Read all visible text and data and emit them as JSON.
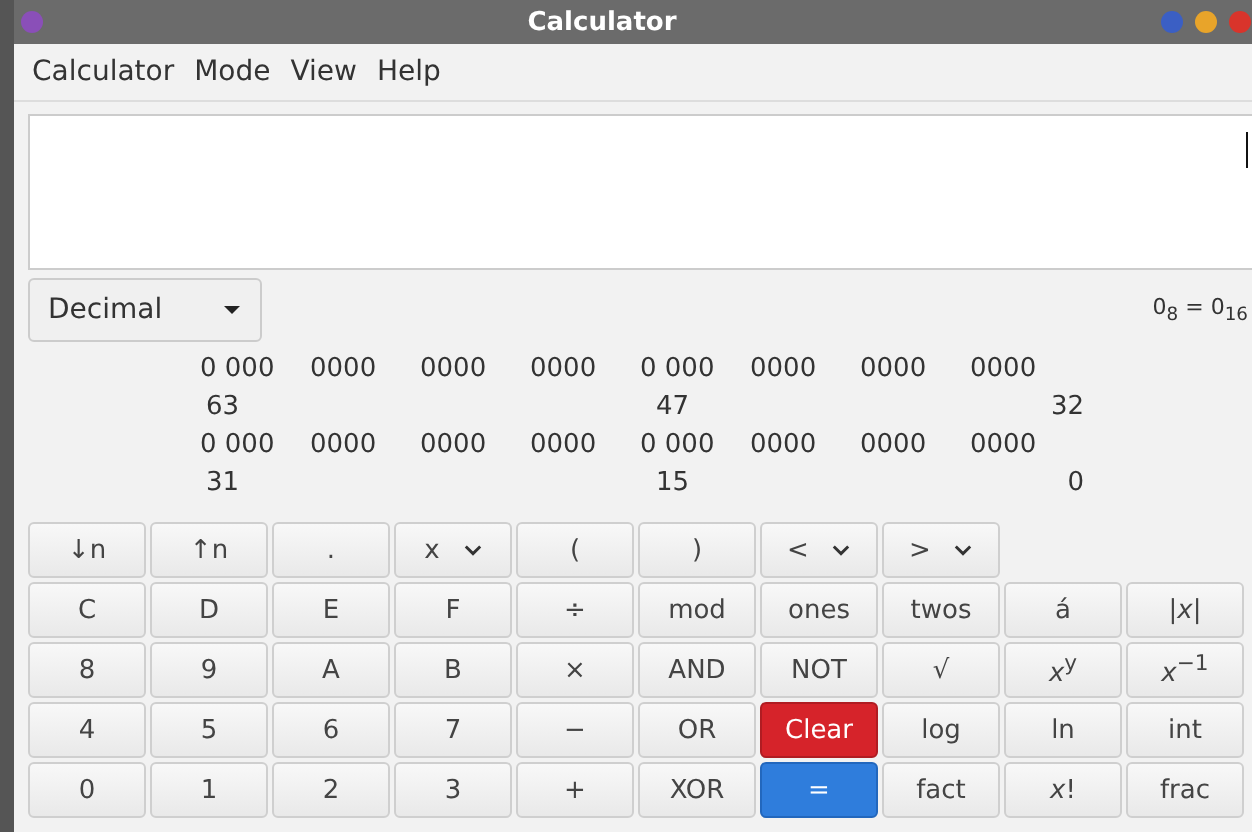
{
  "window": {
    "title": "Calculator"
  },
  "menu": [
    "Calculator",
    "Mode",
    "View",
    "Help"
  ],
  "base_select": {
    "value": "Decimal"
  },
  "conversion": "0$_{8}$ = 0$_{16}$",
  "bits": [
    {
      "groups": [
        "0 000",
        "0000",
        "0000",
        "0000",
        "0 000",
        "0000",
        "0000",
        "0000"
      ],
      "labels": [
        "63",
        "47",
        "32"
      ]
    },
    {
      "groups": [
        "0 000",
        "0000",
        "0000",
        "0000",
        "0 000",
        "0000",
        "0000",
        "0000"
      ],
      "labels": [
        "31",
        "15",
        "0"
      ]
    }
  ],
  "buttons": [
    [
      {
        "label": "↓n",
        "kind": "normal"
      },
      {
        "label": "↑n",
        "kind": "normal"
      },
      {
        "label": ".",
        "kind": "normal"
      },
      {
        "label": "x",
        "kind": "dropdown"
      },
      {
        "label": "(",
        "kind": "normal"
      },
      {
        "label": ")",
        "kind": "normal"
      },
      {
        "label": "<",
        "kind": "dropdown"
      },
      {
        "label": ">",
        "kind": "dropdown"
      }
    ],
    [
      {
        "label": "C",
        "kind": "normal"
      },
      {
        "label": "D",
        "kind": "normal"
      },
      {
        "label": "E",
        "kind": "normal"
      },
      {
        "label": "F",
        "kind": "normal"
      },
      {
        "label": "÷",
        "kind": "normal"
      },
      {
        "label": "mod",
        "kind": "normal"
      },
      {
        "label": "ones",
        "kind": "normal"
      },
      {
        "label": "twos",
        "kind": "normal"
      },
      {
        "label": "á",
        "kind": "normal"
      },
      {
        "label": "|*x*|",
        "kind": "normal"
      }
    ],
    [
      {
        "label": "8",
        "kind": "normal"
      },
      {
        "label": "9",
        "kind": "normal"
      },
      {
        "label": "A",
        "kind": "normal"
      },
      {
        "label": "B",
        "kind": "normal"
      },
      {
        "label": "×",
        "kind": "normal"
      },
      {
        "label": "AND",
        "kind": "normal"
      },
      {
        "label": "NOT",
        "kind": "normal"
      },
      {
        "label": "√",
        "kind": "normal"
      },
      {
        "label": "*x*$^{y}$",
        "kind": "normal"
      },
      {
        "label": "*x*$^{−1}$",
        "kind": "normal"
      }
    ],
    [
      {
        "label": "4",
        "kind": "normal"
      },
      {
        "label": "5",
        "kind": "normal"
      },
      {
        "label": "6",
        "kind": "normal"
      },
      {
        "label": "7",
        "kind": "normal"
      },
      {
        "label": "−",
        "kind": "normal"
      },
      {
        "label": "OR",
        "kind": "normal"
      },
      {
        "label": "Clear",
        "kind": "destructive"
      },
      {
        "label": "log",
        "kind": "normal"
      },
      {
        "label": "ln",
        "kind": "normal"
      },
      {
        "label": "int",
        "kind": "normal"
      }
    ],
    [
      {
        "label": "0",
        "kind": "normal"
      },
      {
        "label": "1",
        "kind": "normal"
      },
      {
        "label": "2",
        "kind": "normal"
      },
      {
        "label": "3",
        "kind": "normal"
      },
      {
        "label": "+",
        "kind": "normal"
      },
      {
        "label": "XOR",
        "kind": "normal"
      },
      {
        "label": "=",
        "kind": "suggested"
      },
      {
        "label": "fact",
        "kind": "normal"
      },
      {
        "label": "*x*!",
        "kind": "normal"
      },
      {
        "label": "frac",
        "kind": "normal"
      }
    ]
  ]
}
